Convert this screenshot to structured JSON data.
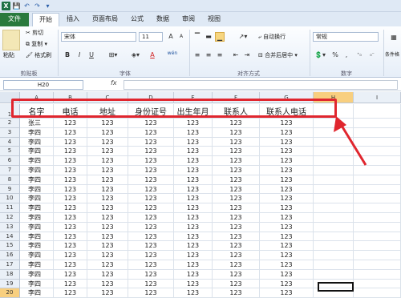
{
  "titlebar": {
    "qat": [
      "X",
      "💾",
      "↶",
      "↷",
      "▾"
    ]
  },
  "ribbon_tabs": [
    "文件",
    "开始",
    "插入",
    "页面布局",
    "公式",
    "数据",
    "审阅",
    "视图"
  ],
  "clipboard": {
    "paste": "粘贴",
    "cut": "剪切",
    "copy": "复制 ▾",
    "format_painter": "格式刷",
    "label": "剪贴板"
  },
  "font": {
    "name": "宋体",
    "size": "11",
    "label": "字体",
    "bold": "B",
    "italic": "I",
    "underline": "U",
    "grow": "A",
    "shrink": "A",
    "font_color": "A",
    "wen": "wén"
  },
  "alignment": {
    "wrap": "自动换行",
    "merge": "合并后居中 ▾",
    "label": "对齐方式"
  },
  "number": {
    "format": "常规",
    "label": "数字",
    "percent": "%",
    "comma": ","
  },
  "styles": {
    "label": "条件格"
  },
  "formula_bar": {
    "name_box": "H20",
    "fx": "fx",
    "content": ""
  },
  "columns": [
    "A",
    "B",
    "C",
    "D",
    "E",
    "F",
    "G",
    "H",
    "I"
  ],
  "header_row": [
    "名字",
    "电话",
    "地址",
    "身份证号",
    "出生年月",
    "联系人",
    "联系人电话"
  ],
  "rows": [
    [
      "张三",
      "123",
      "123",
      "123",
      "123",
      "123",
      "123"
    ],
    [
      "李四",
      "123",
      "123",
      "123",
      "123",
      "123",
      "123"
    ],
    [
      "李四",
      "123",
      "123",
      "123",
      "123",
      "123",
      "123"
    ],
    [
      "李四",
      "123",
      "123",
      "123",
      "123",
      "123",
      "123"
    ],
    [
      "李四",
      "123",
      "123",
      "123",
      "123",
      "123",
      "123"
    ],
    [
      "李四",
      "123",
      "123",
      "123",
      "123",
      "123",
      "123"
    ],
    [
      "李四",
      "123",
      "123",
      "123",
      "123",
      "123",
      "123"
    ],
    [
      "李四",
      "123",
      "123",
      "123",
      "123",
      "123",
      "123"
    ],
    [
      "李四",
      "123",
      "123",
      "123",
      "123",
      "123",
      "123"
    ],
    [
      "李四",
      "123",
      "123",
      "123",
      "123",
      "123",
      "123"
    ],
    [
      "李四",
      "123",
      "123",
      "123",
      "123",
      "123",
      "123"
    ],
    [
      "李四",
      "123",
      "123",
      "123",
      "123",
      "123",
      "123"
    ],
    [
      "李四",
      "123",
      "123",
      "123",
      "123",
      "123",
      "123"
    ],
    [
      "李四",
      "123",
      "123",
      "123",
      "123",
      "123",
      "123"
    ],
    [
      "李四",
      "123",
      "123",
      "123",
      "123",
      "123",
      "123"
    ],
    [
      "李四",
      "123",
      "123",
      "123",
      "123",
      "123",
      "123"
    ],
    [
      "李四",
      "123",
      "123",
      "123",
      "123",
      "123",
      "123"
    ],
    [
      "李四",
      "123",
      "123",
      "123",
      "123",
      "123",
      "123"
    ],
    [
      "李四",
      "123",
      "123",
      "123",
      "123",
      "123",
      "123"
    ]
  ],
  "colors": {
    "annotation": "#e0262e",
    "selected_header": "#f8cf7f",
    "file_tab": "#2a7a3d"
  }
}
